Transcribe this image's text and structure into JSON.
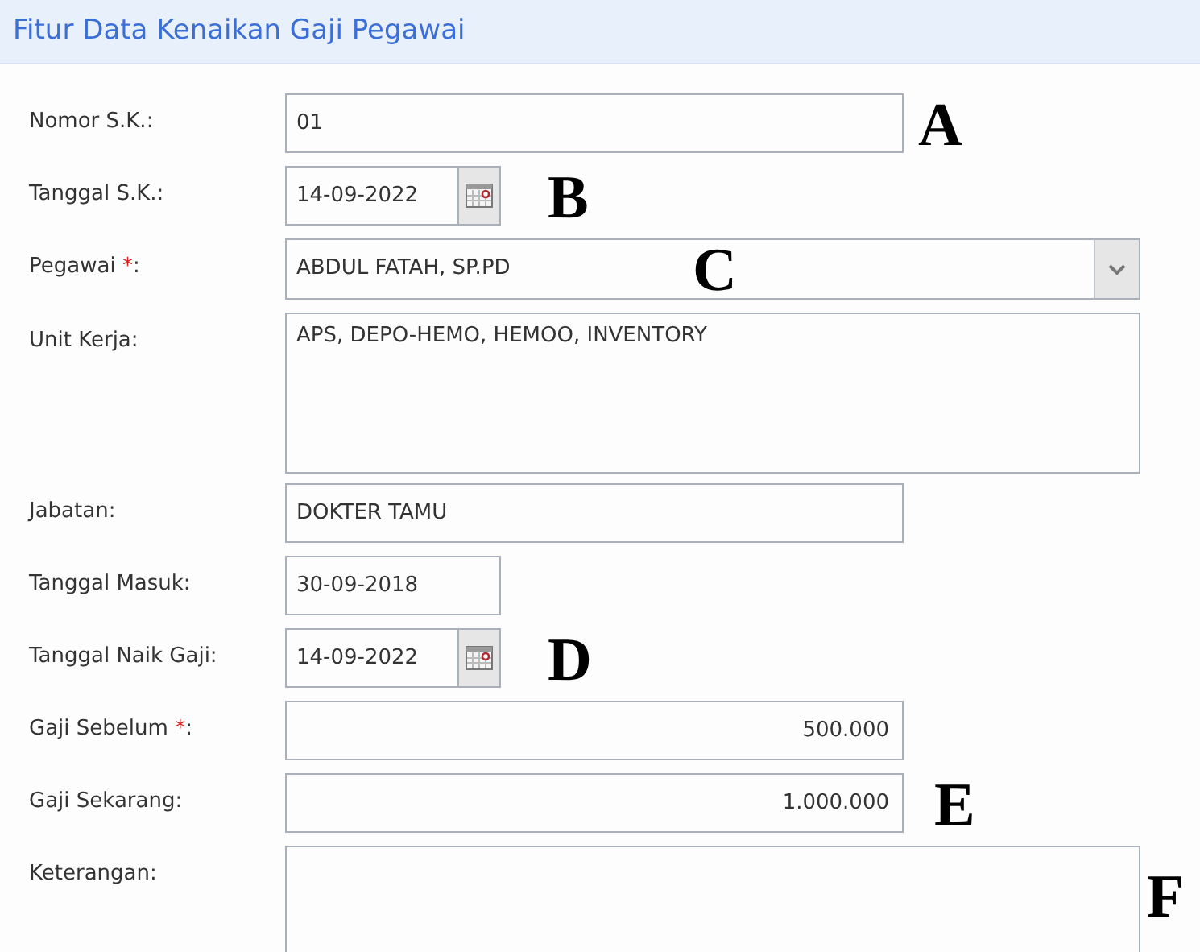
{
  "title": "Fitur Data Kenaikan Gaji Pegawai",
  "fields": [
    {
      "kind": "text",
      "label": "Nomor S.K.:",
      "value": "01",
      "annotation": "A"
    },
    {
      "kind": "date",
      "label": "Tanggal S.K.:",
      "value": "14-09-2022",
      "annotation": "B"
    },
    {
      "kind": "select",
      "label": "Pegawai",
      "required_mark": "*",
      "label_end": ":",
      "value": "ABDUL FATAH, SP.PD",
      "annotation": "C"
    },
    {
      "kind": "textarea",
      "label": "Unit Kerja:",
      "value": "APS, DEPO-HEMO, HEMOO, INVENTORY"
    },
    {
      "kind": "text",
      "label": "Jabatan:",
      "value": "DOKTER TAMU"
    },
    {
      "kind": "short",
      "label": "Tanggal Masuk:",
      "value": "30-09-2018"
    },
    {
      "kind": "date",
      "label": "Tanggal Naik Gaji:",
      "value": "14-09-2022",
      "annotation": "D"
    },
    {
      "kind": "number",
      "label": "Gaji Sebelum",
      "required_mark": "*",
      "label_end": ":",
      "value": "500.000"
    },
    {
      "kind": "number",
      "label": "Gaji Sekarang:",
      "value": "1.000.000",
      "annotation": "E"
    },
    {
      "kind": "tall",
      "label": "Keterangan:",
      "annotation": "F"
    }
  ]
}
